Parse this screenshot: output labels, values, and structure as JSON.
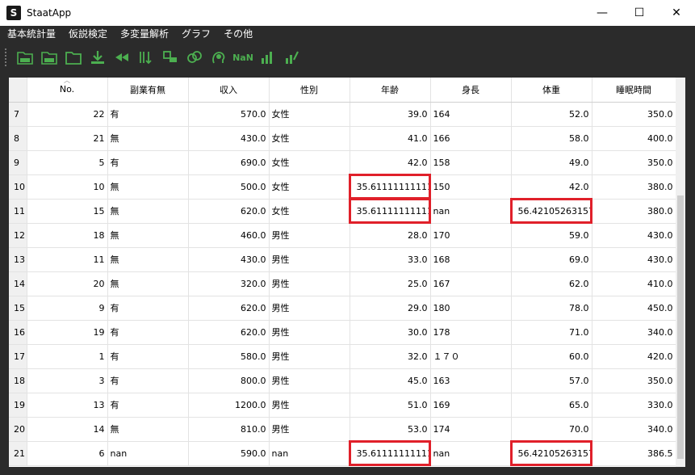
{
  "window": {
    "title": "StaatApp",
    "icon_letter": "S",
    "controls": {
      "minimize": "—",
      "maximize": "☐",
      "close": "✕"
    }
  },
  "menu": [
    "基本統計量",
    "仮説検定",
    "多変量解析",
    "グラフ",
    "その他"
  ],
  "toolbar": {
    "tools": [
      "csv-import-icon",
      "xlsx-import-icon",
      "open-folder-icon",
      "download-icon",
      "rewind-icon",
      "sort-icon",
      "transform-icon",
      "coins-icon",
      "head-icon",
      "nan-icon",
      "bar-export-icon",
      "bar-edit-icon"
    ],
    "nan_label": "NaN",
    "accent": "#4caf50"
  },
  "table": {
    "columns": [
      "No.",
      "副業有無",
      "収入",
      "性別",
      "年齢",
      "身長",
      "体重",
      "睡眠時間"
    ],
    "rows": [
      {
        "idx": "7",
        "cells": [
          "22",
          "有",
          "570.0",
          "女性",
          "39.0",
          "164",
          "52.0",
          "350.0"
        ]
      },
      {
        "idx": "8",
        "cells": [
          "21",
          "無",
          "430.0",
          "女性",
          "41.0",
          "166",
          "58.0",
          "400.0"
        ]
      },
      {
        "idx": "9",
        "cells": [
          "5",
          "有",
          "690.0",
          "女性",
          "42.0",
          "158",
          "49.0",
          "350.0"
        ]
      },
      {
        "idx": "10",
        "cells": [
          "10",
          "無",
          "500.0",
          "女性",
          "35.61111111111...",
          "150",
          "42.0",
          "380.0"
        ]
      },
      {
        "idx": "11",
        "cells": [
          "15",
          "無",
          "620.0",
          "女性",
          "35.61111111111...",
          "nan",
          "56.42105263157...",
          "380.0"
        ]
      },
      {
        "idx": "12",
        "cells": [
          "18",
          "無",
          "460.0",
          "男性",
          "28.0",
          "170",
          "59.0",
          "430.0"
        ]
      },
      {
        "idx": "13",
        "cells": [
          "11",
          "無",
          "430.0",
          "男性",
          "33.0",
          "168",
          "69.0",
          "430.0"
        ]
      },
      {
        "idx": "14",
        "cells": [
          "20",
          "無",
          "320.0",
          "男性",
          "25.0",
          "167",
          "62.0",
          "410.0"
        ]
      },
      {
        "idx": "15",
        "cells": [
          "9",
          "有",
          "620.0",
          "男性",
          "29.0",
          "180",
          "78.0",
          "450.0"
        ]
      },
      {
        "idx": "16",
        "cells": [
          "19",
          "有",
          "620.0",
          "男性",
          "30.0",
          "178",
          "71.0",
          "340.0"
        ]
      },
      {
        "idx": "17",
        "cells": [
          "1",
          "有",
          "580.0",
          "男性",
          "32.0",
          "１７０",
          "60.0",
          "420.0"
        ]
      },
      {
        "idx": "18",
        "cells": [
          "3",
          "有",
          "800.0",
          "男性",
          "45.0",
          "163",
          "57.0",
          "350.0"
        ]
      },
      {
        "idx": "19",
        "cells": [
          "13",
          "有",
          "1200.0",
          "男性",
          "51.0",
          "169",
          "65.0",
          "330.0"
        ]
      },
      {
        "idx": "20",
        "cells": [
          "14",
          "無",
          "810.0",
          "男性",
          "53.0",
          "174",
          "70.0",
          "340.0"
        ]
      },
      {
        "idx": "21",
        "cells": [
          "6",
          "nan",
          "590.0",
          "nan",
          "35.61111111111...",
          "nan",
          "56.42105263157...",
          "386.5"
        ]
      }
    ],
    "highlight_color": "#e0202a"
  }
}
